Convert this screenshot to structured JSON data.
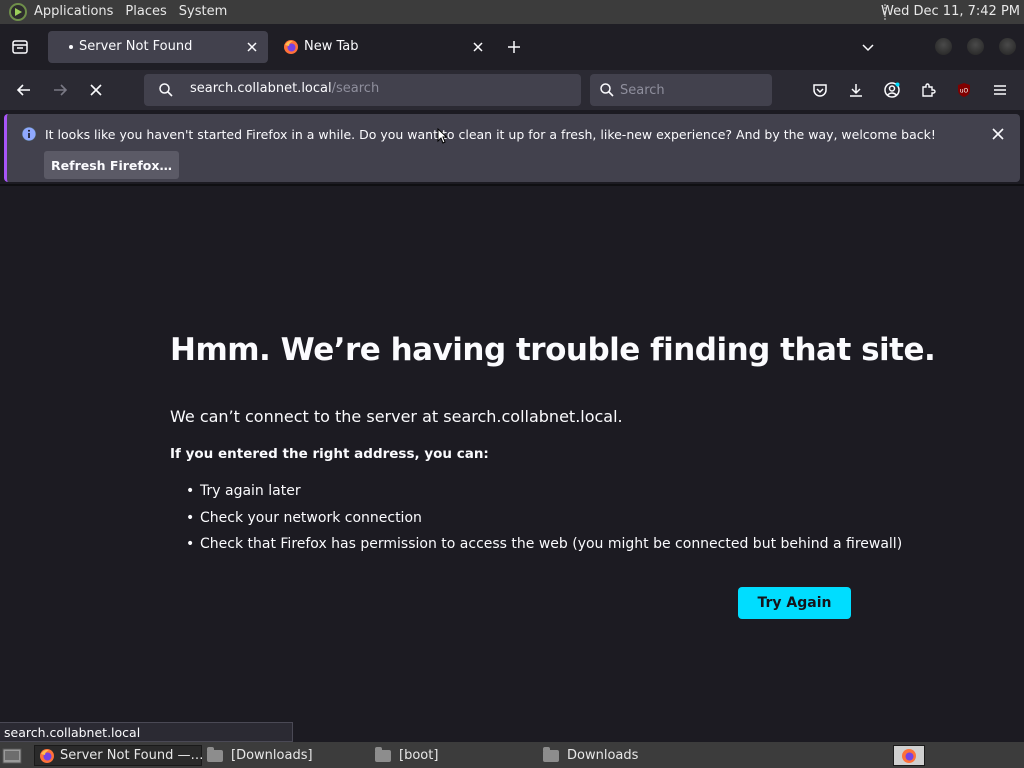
{
  "topbar": {
    "menus": [
      "Applications",
      "Places",
      "System"
    ],
    "clock": "Wed Dec 11,  7:42 PM"
  },
  "tabs": [
    {
      "label": "Server Not Found",
      "active": true
    },
    {
      "label": "New Tab",
      "active": false
    }
  ],
  "navbar": {
    "url_host": "search.collabnet.local",
    "url_path": "/search",
    "search_placeholder": "Search"
  },
  "notification": {
    "message": "It looks like you haven't started Firefox in a while. Do you want to clean it up for a fresh, like-new experience? And by the way, welcome back!",
    "button_label": "Refresh Firefox…"
  },
  "error_page": {
    "title": "Hmm. We’re having trouble finding that site.",
    "description": "We can’t connect to the server at search.collabnet.local.",
    "intro": "If you entered the right address, you can:",
    "suggestions": [
      "Try again later",
      "Check your network connection",
      "Check that Firefox has permission to access the web (you might be connected but behind a firewall)"
    ],
    "try_again_label": "Try Again"
  },
  "status_link": "search.collabnet.local",
  "taskbar": {
    "items": [
      {
        "label": "Server Not Found —…",
        "active": true
      },
      {
        "label": "[Downloads]",
        "active": false
      },
      {
        "label": "[boot]",
        "active": false
      },
      {
        "label": "Downloads",
        "active": false
      }
    ]
  },
  "colors": {
    "accent": "#00ddff",
    "page_background": "#1c1b22",
    "notification_stripe": "#a855f7"
  }
}
